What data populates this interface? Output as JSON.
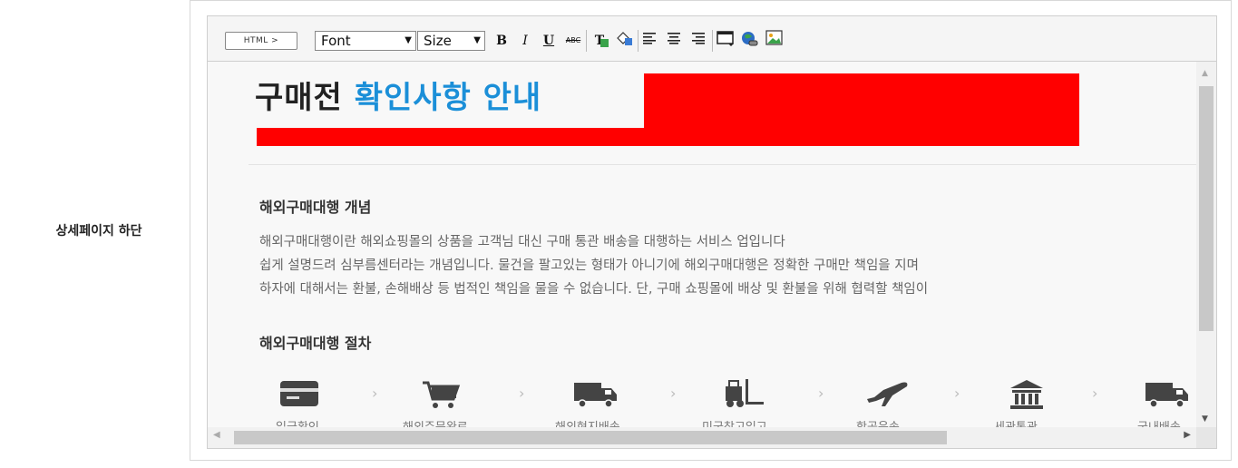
{
  "row": {
    "label": "상세페이지 하단"
  },
  "toolbar": {
    "html_label": "HTML >",
    "font_label": "Font",
    "size_label": "Size",
    "bold": "B",
    "italic": "I",
    "underline": "U",
    "strike": "ABC",
    "text_color": "T",
    "align_left": "≡",
    "align_center": "≡",
    "align_right": "≡"
  },
  "content": {
    "title_part1": "구매전",
    "title_part2": "확인사항 안내",
    "section1": {
      "heading": "해외구매대행 개념",
      "lines": [
        "해외구매대행이란 해외쇼핑몰의 상품을 고객님 대신 구매 통관 배송을 대행하는 서비스 업입니다",
        "쉽게 설명드려 심부름센터라는 개념입니다. 물건을 팔고있는 형태가 아니기에 해외구매대행은 정확한 구매만 책임을 지며",
        "하자에 대해서는 환불, 손해배상 등 법적인 책임을 물을 수 없습니다. 단, 구매 쇼핑몰에 배상 및 환불을 위해 협력할 책임이"
      ]
    },
    "section2": {
      "heading": "해외구매대행 절차",
      "steps": [
        {
          "icon": "credit-card-icon",
          "label": "입금확인"
        },
        {
          "icon": "cart-icon",
          "label": "해외주문완료"
        },
        {
          "icon": "truck-icon",
          "label": "해외현지배송"
        },
        {
          "icon": "forklift-icon",
          "label": "미국창고입고"
        },
        {
          "icon": "airplane-icon",
          "label": "항공운송"
        },
        {
          "icon": "bank-icon",
          "label": "세관통관"
        },
        {
          "icon": "truck-icon",
          "label": "국내배송"
        }
      ]
    }
  }
}
